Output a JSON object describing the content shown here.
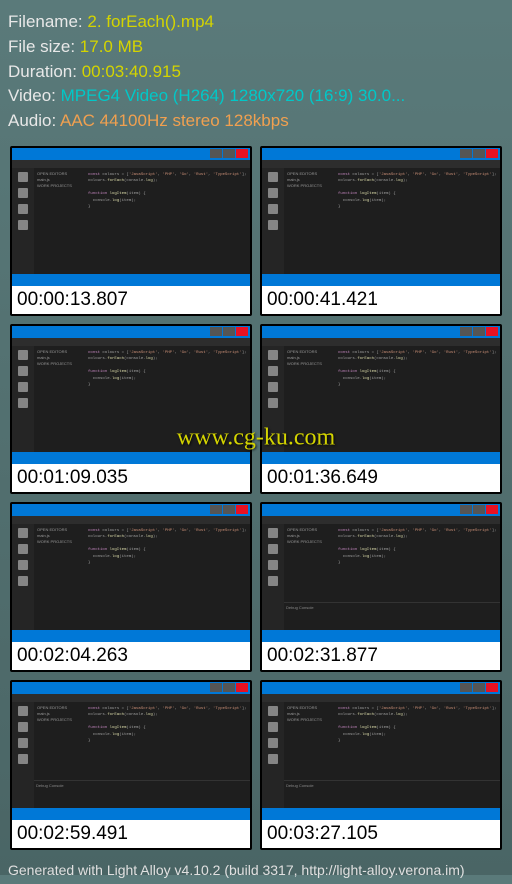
{
  "info": {
    "filename_label": "Filename: ",
    "filename_value": "2. forEach().mp4",
    "filesize_label": "File size: ",
    "filesize_value": "17.0 MB",
    "duration_label": "Duration: ",
    "duration_value": "00:03:40.915",
    "video_label": "Video: ",
    "video_value": "MPEG4 Video (H264) 1280x720 (16:9) 30.0...",
    "audio_label": "Audio: ",
    "audio_value": "AAC 44100Hz stereo 128kbps"
  },
  "thumbnails": [
    {
      "timestamp": "00:00:13.807"
    },
    {
      "timestamp": "00:00:41.421"
    },
    {
      "timestamp": "00:01:09.035"
    },
    {
      "timestamp": "00:01:36.649"
    },
    {
      "timestamp": "00:02:04.263"
    },
    {
      "timestamp": "00:02:31.877"
    },
    {
      "timestamp": "00:02:59.491"
    },
    {
      "timestamp": "00:03:27.105"
    }
  ],
  "watermark": "www.cg-ku.com",
  "footer": "Generated with Light Alloy v4.10.2 (build 3317, http://light-alloy.verona.im)",
  "sidebar_items": [
    "OPEN EDITORS",
    "main.js",
    "WORK PROJECTS"
  ],
  "code_sample": "const colours = ['JavaScript', 'PHP', 'Go', 'Rust', 'TypeScript'];"
}
